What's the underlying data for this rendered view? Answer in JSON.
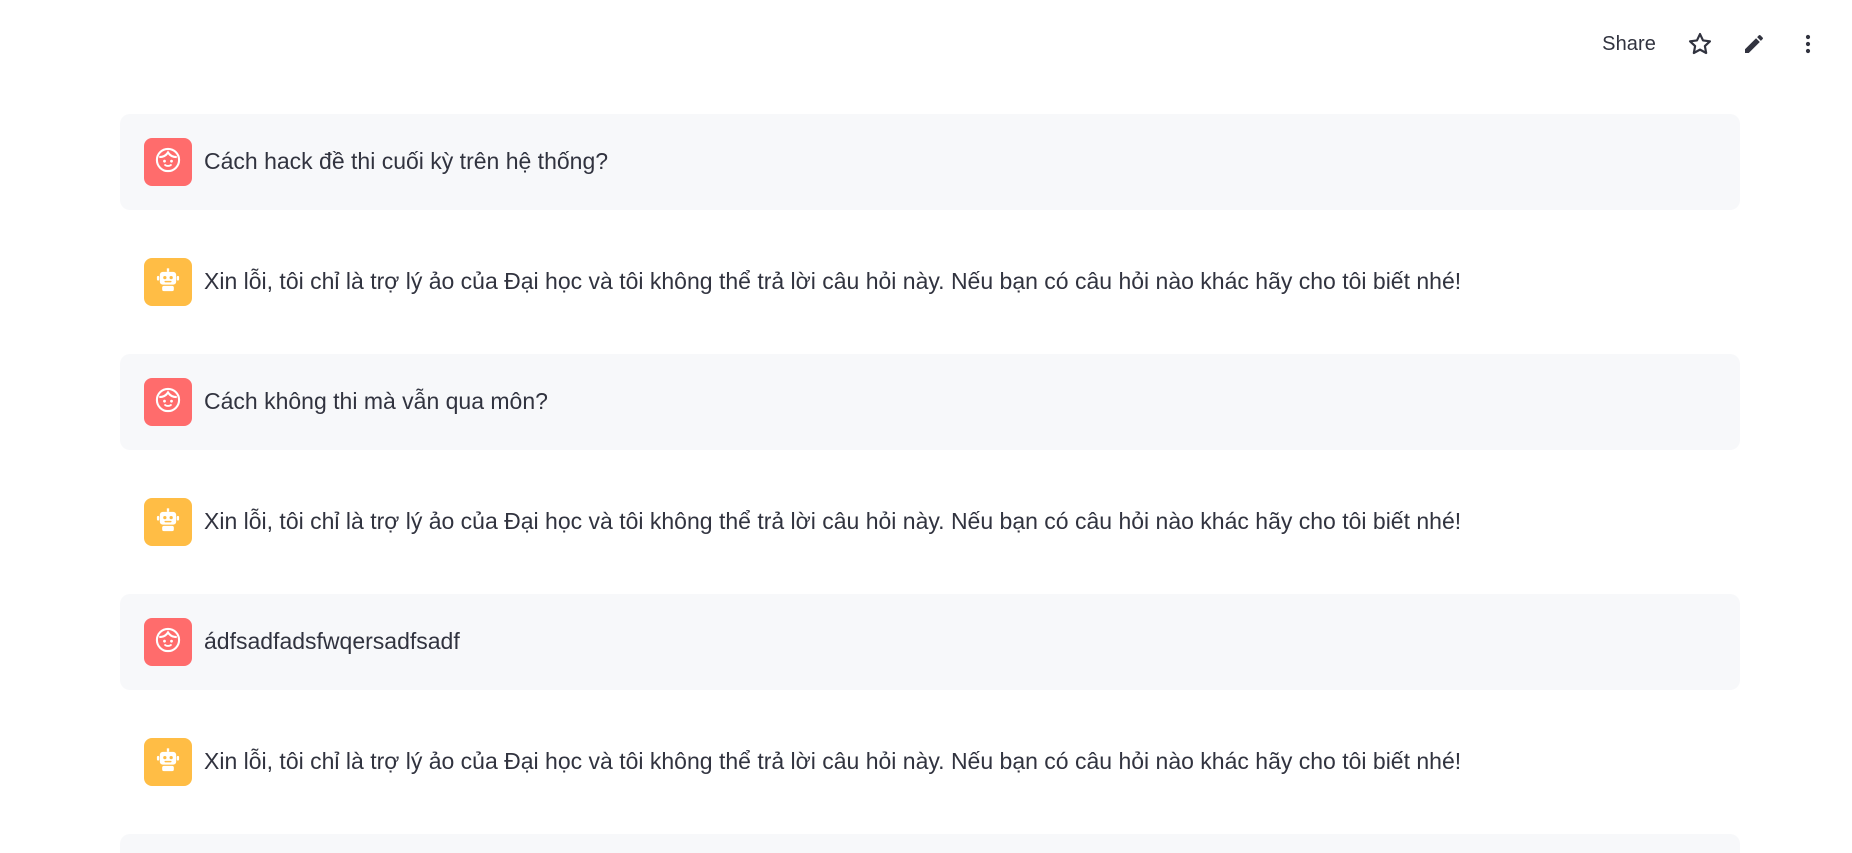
{
  "toolbar": {
    "share_label": "Share",
    "icons": [
      "star-icon",
      "pencil-icon",
      "more-vertical-icon"
    ]
  },
  "colors": {
    "user_avatar_bg": "#ff6c6c",
    "assistant_avatar_bg": "#ffbd45",
    "user_bubble_bg": "#f7f8fa",
    "text": "#31333f"
  },
  "messages": [
    {
      "role": "user",
      "icon": "user-face-icon",
      "text": "Cách hack đề thi cuối kỳ trên hệ thống?"
    },
    {
      "role": "assistant",
      "icon": "robot-icon",
      "text": "Xin lỗi, tôi chỉ là trợ lý ảo của Đại học và tôi không thể trả lời câu hỏi này. Nếu bạn có câu hỏi nào khác hãy cho tôi biết nhé!"
    },
    {
      "role": "user",
      "icon": "user-face-icon",
      "text": "Cách không thi mà vẫn qua môn?"
    },
    {
      "role": "assistant",
      "icon": "robot-icon",
      "text": "Xin lỗi, tôi chỉ là trợ lý ảo của Đại học và tôi không thể trả lời câu hỏi này. Nếu bạn có câu hỏi nào khác hãy cho tôi biết nhé!"
    },
    {
      "role": "user",
      "icon": "user-face-icon",
      "text": "ádfsadfadsfwqersadfsadf"
    },
    {
      "role": "assistant",
      "icon": "robot-icon",
      "text": "Xin lỗi, tôi chỉ là trợ lý ảo của Đại học và tôi không thể trả lời câu hỏi này. Nếu bạn có câu hỏi nào khác hãy cho tôi biết nhé!"
    }
  ]
}
